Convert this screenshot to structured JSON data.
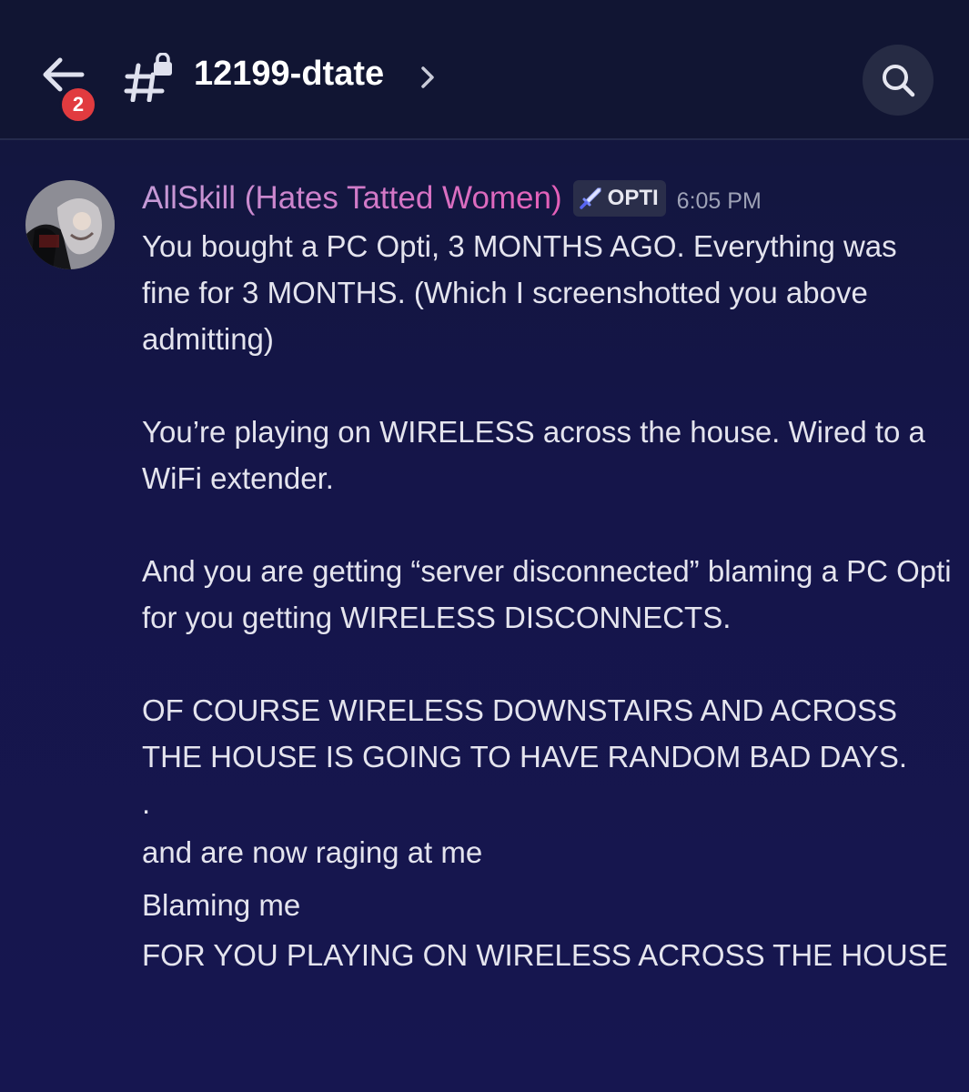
{
  "header": {
    "back_badge_count": "2",
    "channel_name": "12199-dtate",
    "icons": {
      "back": "arrow-left-icon",
      "channel": "locked-hash-icon",
      "chevron": "chevron-right-icon",
      "search": "search-icon"
    }
  },
  "message": {
    "author": "AllSkill (Hates Tatted Women)",
    "tag_icon": "sword-icon",
    "tag": "OPTI",
    "timestamp": "6:05 PM",
    "paragraphs": [
      "You bought a PC Opti, 3 MONTHS AGO. Everything was fine for 3 MONTHS. (Which I screenshotted you above admitting)",
      "You’re playing on WIRELESS across the house. Wired to a WiFi extender.",
      "And you are getting “server disconnected” blaming a PC Opti for you getting WIRELESS DISCONNECTS.",
      "OF COURSE WIRELESS DOWNSTAIRS AND ACROSS THE HOUSE IS GOING TO HAVE RANDOM BAD DAYS.",
      "."
    ],
    "lines": [
      "and are now raging at me",
      "Blaming me",
      "FOR YOU PLAYING ON WIRELESS ACROSS THE HOUSE"
    ]
  },
  "colors": {
    "background": "#15154a",
    "topbar": "#111533",
    "badge": "#e13b3f",
    "username_gradient_start": "#c49ad6",
    "username_gradient_end": "#e45fb8",
    "timestamp": "#9ea2b6"
  }
}
